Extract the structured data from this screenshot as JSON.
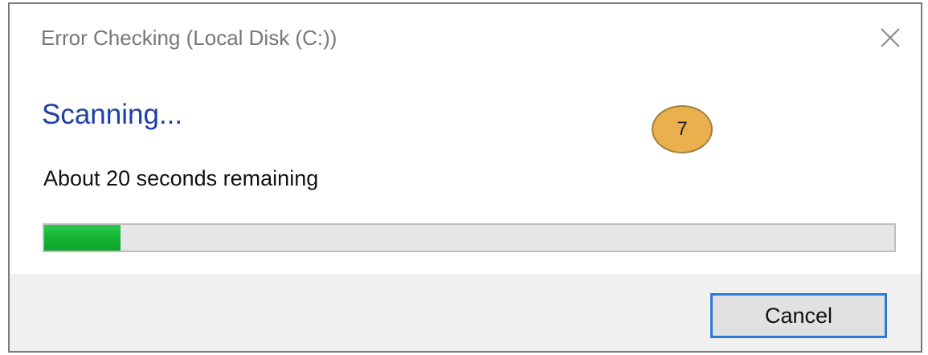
{
  "dialog": {
    "title": "Error Checking (Local Disk (C:))",
    "close_icon": "close-icon"
  },
  "content": {
    "heading": "Scanning...",
    "badge_number": "7",
    "remaining_text": "About 20 seconds remaining",
    "progress_fraction": 0.09
  },
  "footer": {
    "cancel_label": "Cancel"
  },
  "colors": {
    "heading": "#1e3fa8",
    "badge": "#e9b04e",
    "progress_fill": "#13b232",
    "progress_track": "#e6e6e6",
    "button_focus_border": "#2a7ad8",
    "footer_background": "#f0f0f0"
  }
}
